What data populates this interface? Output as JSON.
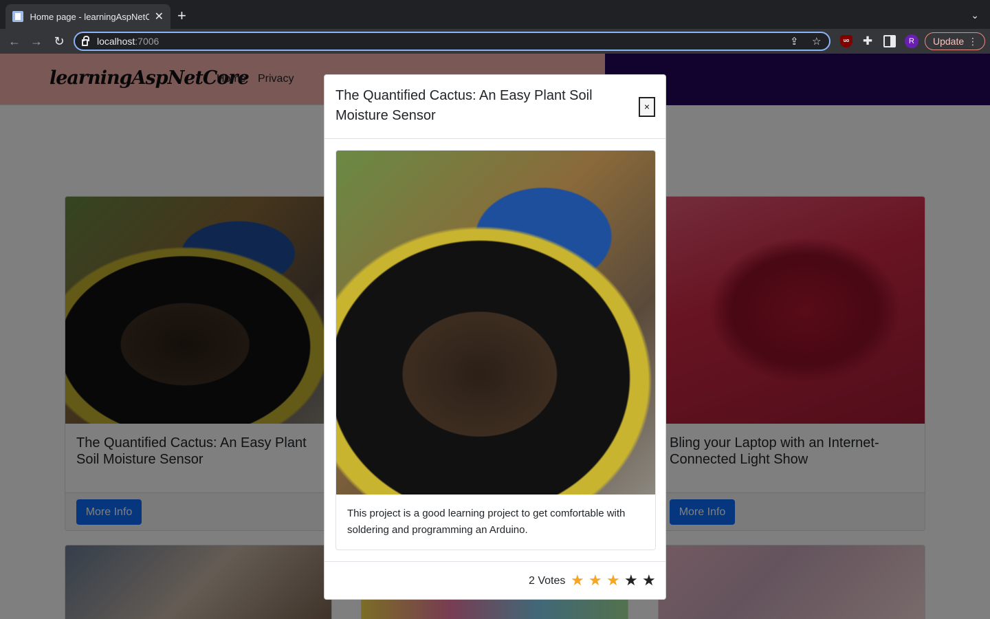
{
  "browser": {
    "tab_title": "Home page - learningAspNetC",
    "url_host": "localhost",
    "url_port": ":7006",
    "avatar_letter": "R",
    "update_label": "Update"
  },
  "site": {
    "brand": "learningAspNetCore",
    "nav": [
      "Home",
      "Privacy"
    ],
    "header_colors": {
      "left": "#f2b0ad",
      "right": "#23075a"
    }
  },
  "cards": [
    {
      "title": "The Quantified Cactus: An Easy Plant Soil Moisture Sensor",
      "button": "More Info"
    },
    {
      "title": "Bling your Laptop with an Internet-Connected Light Show",
      "button": "More Info"
    }
  ],
  "modal": {
    "title": "The Quantified Cactus: An Easy Plant Soil Moisture Sensor",
    "close": "×",
    "description": "This project is a good learning project to get comfortable with soldering and programming an Arduino.",
    "votes": "2 Votes",
    "rating": 3,
    "max_rating": 5,
    "star_colors": {
      "filled": "#f5a623",
      "empty": "#222222"
    }
  }
}
